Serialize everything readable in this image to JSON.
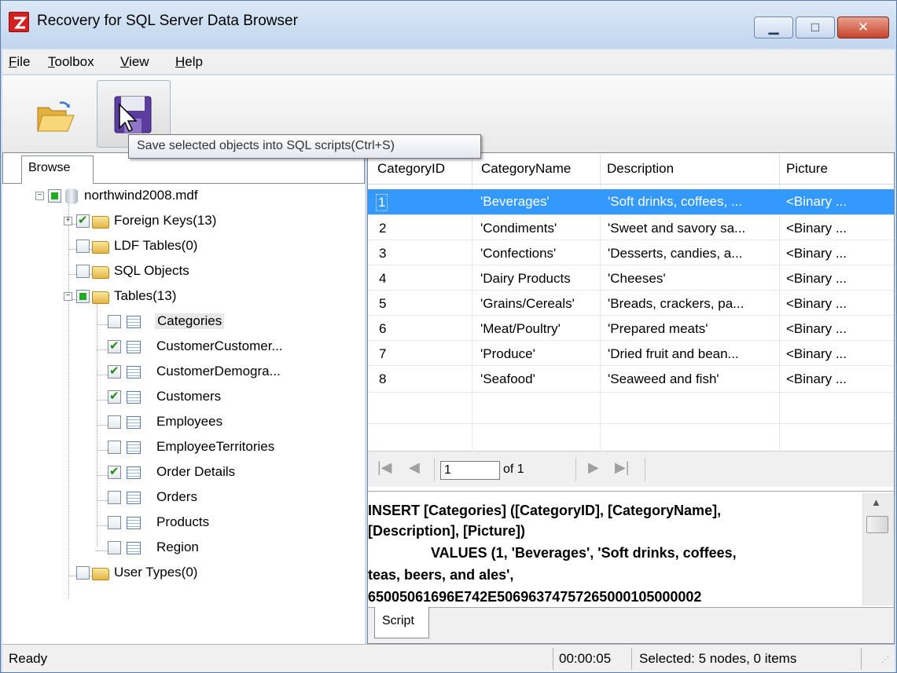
{
  "window": {
    "title": "Recovery for SQL Server Data Browser"
  },
  "menu": [
    {
      "label": "File",
      "ul": "F",
      "rest": "ile"
    },
    {
      "label": "Toolbox",
      "ul": "T",
      "rest": "oolbox"
    },
    {
      "label": "View",
      "ul": "V",
      "rest": "iew"
    },
    {
      "label": "Help",
      "ul": "H",
      "rest": "elp"
    }
  ],
  "toolbar": {
    "open_icon": "folder-open-icon",
    "save_icon": "floppy-disk-icon",
    "tooltip": "Save selected objects into SQL scripts(Ctrl+S)"
  },
  "left_tab": "Browse",
  "tree": {
    "root": "northwind2008.mdf",
    "foreign_keys": "Foreign Keys(13)",
    "ldf_tables": "LDF Tables(0)",
    "sql_objects": "SQL Objects",
    "tables": "Tables(13)",
    "table_items": [
      {
        "label": "Categories",
        "checked": false
      },
      {
        "label": "CustomerCustomer...",
        "checked": true
      },
      {
        "label": "CustomerDemogra...",
        "checked": true
      },
      {
        "label": "Customers",
        "checked": true
      },
      {
        "label": "Employees",
        "checked": false
      },
      {
        "label": "EmployeeTerritories",
        "checked": false
      },
      {
        "label": "Order Details",
        "checked": true
      },
      {
        "label": "Orders",
        "checked": false
      },
      {
        "label": "Products",
        "checked": false
      },
      {
        "label": "Region",
        "checked": false
      }
    ],
    "user_types": "User Types(0)"
  },
  "grid": {
    "columns": [
      "CategoryID",
      "CategoryName",
      "Description",
      "Picture"
    ],
    "rows": [
      [
        "1",
        "'Beverages'",
        "'Soft drinks, coffees, ...",
        "<Binary ..."
      ],
      [
        "2",
        "'Condiments'",
        "'Sweet and savory sa...",
        "<Binary ..."
      ],
      [
        "3",
        "'Confections'",
        "'Desserts, candies, a...",
        "<Binary ..."
      ],
      [
        "4",
        "'Dairy Products",
        "'Cheeses'",
        "<Binary ..."
      ],
      [
        "5",
        "'Grains/Cereals'",
        "'Breads, crackers, pa...",
        "<Binary ..."
      ],
      [
        "6",
        "'Meat/Poultry'",
        "'Prepared meats'",
        "<Binary ..."
      ],
      [
        "7",
        "'Produce'",
        "'Dried fruit and bean...",
        "<Binary ..."
      ],
      [
        "8",
        "'Seafood'",
        "'Seaweed and fish'",
        "<Binary ..."
      ]
    ]
  },
  "pager": {
    "page": "1",
    "of": "of 1"
  },
  "script": {
    "lines": [
      "INSERT [Categories] ([CategoryID], [CategoryName],",
      "[Description], [Picture])",
      "VALUES (1, 'Beverages', 'Soft drinks, coffees,",
      "teas, beers, and ales',",
      "65005061696E742E50696374757265000105000002"
    ],
    "tab": "Script"
  },
  "status": {
    "text": "Ready",
    "time": "00:00:05",
    "selected": "Selected: 5 nodes, 0 items"
  }
}
